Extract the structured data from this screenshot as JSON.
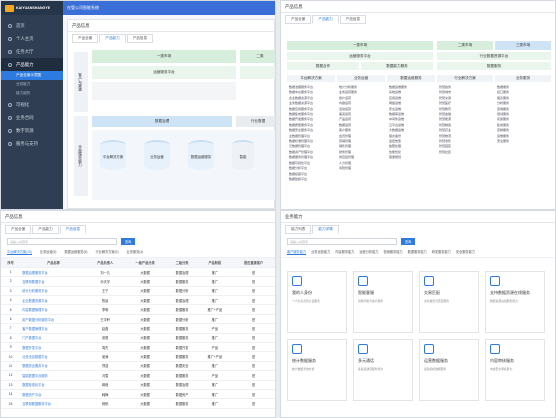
{
  "app": {
    "logo_text": "KAIYUANSHANGYE",
    "top_title": "在管公司智能系统"
  },
  "sidebar": {
    "items": [
      {
        "label": "首页"
      },
      {
        "label": "个人主页"
      },
      {
        "label": "任务大厅"
      },
      {
        "label": "产品能力"
      },
      {
        "label": "可视化"
      },
      {
        "label": "业务合同"
      },
      {
        "label": "数字资源"
      },
      {
        "label": "服务与支持"
      }
    ],
    "subitems": [
      {
        "label": "产品全景示意图"
      },
      {
        "label": "业务能力"
      },
      {
        "label": "能力组件"
      }
    ]
  },
  "panel1": {
    "title": "产品信息",
    "tabs": [
      "产品全景",
      "产品能力",
      "产品信息"
    ],
    "label_left_top": "客户与渠道",
    "label_left_bottom": "全面服务能力",
    "block1": "一类市场",
    "block2": "运营服务平台",
    "block3": "二类",
    "block4": "数据治理",
    "block5": "行业数据",
    "cyl1": "平台解决方案",
    "cyl2": "业务运营",
    "cyl3": "数据运维服务",
    "cyl4": "智能"
  },
  "panel2": {
    "title": "产品信息",
    "tabs": [
      "产品全景",
      "产品能力",
      "产品信息"
    ],
    "a1": "一类市场",
    "a2": "运营服务平台",
    "a3": "数据合作",
    "a4": "数据能力服务",
    "b1": "二类市场",
    "b2": "三类市场",
    "b3": "行业数据资源平台",
    "b4": "数据服务",
    "c_head": [
      "平台解决方案",
      "业务运营",
      "数据运维服务",
      "行业解决方案",
      "业务服务"
    ],
    "c1": [
      "数据治理服务平台",
      "数据中台服务平台",
      "企业数据资源平台",
      "业务数据资源平台",
      "数据应用服务平台",
      "数据集成服务平台",
      "数据开发服务平台",
      "数据质量服务平台",
      "数据安全服务平台",
      "主数据管理平台",
      "数据标准管理平台",
      "元数据管理平台",
      "数据资产管理平台",
      "数据服务管理平台",
      "数据可视化平台",
      "数据分析平台",
      "数据挖掘平台",
      "数据建模平台"
    ],
    "c2": [
      "统计分析服务",
      "业务运营服务",
      "用户运营",
      "内容运营",
      "活动运营",
      "渠道运营",
      "产品运营",
      "数据运营",
      "客户服务",
      "会员管理",
      "营销管理",
      "销售管理",
      "财务管理",
      "供应链管理",
      "人力管理",
      "风险管理"
    ],
    "c3": [
      "数据运维服务",
      "系统运维",
      "应用运维",
      "网络运维",
      "安全运维",
      "数据库运维",
      "中间件运维",
      "云平台运维",
      "大数据运维",
      "容灾备份",
      "监控告警",
      "故障处理",
      "性能优化",
      "容量规划"
    ],
    "c4": [
      "智慧政务",
      "智慧城市",
      "智慧交通",
      "智慧医疗",
      "智慧教育",
      "智慧金融",
      "智慧能源",
      "智慧制造",
      "智慧农业",
      "智慧物流",
      "智慧零售",
      "智慧园区",
      "智慧社区"
    ],
    "c5": [
      "数据服务",
      "接口服务",
      "报表服务",
      "分析服务",
      "咨询服务",
      "培训服务",
      "实施服务",
      "集成服务",
      "定制服务",
      "运维服务",
      "安全服务"
    ]
  },
  "panel3": {
    "title": "产品信息",
    "tabs": [
      "产品全景",
      "产品能力",
      "产品信息"
    ],
    "search_placeholder": "请输入关键字",
    "search_btn": "查询",
    "cats": [
      "平台解决方案(15)",
      "业务运营(6)",
      "数据运维服务(5)",
      "行业解决方案(3)",
      "业务服务(4)"
    ],
    "headers": [
      "序号",
      "产品名称",
      "产品负责人",
      "一级产品分类",
      "二级分类",
      "产品阶段",
      "是否直接客户"
    ],
    "rows": [
      [
        "1",
        "数据治理服务平台",
        "刘一凡",
        "大数据",
        "数据治理",
        "推广",
        "是"
      ],
      [
        "2",
        "互联网数据平台",
        "孙天宇",
        "大数据",
        "数据服务",
        "推广",
        "是"
      ],
      [
        "3",
        "统计分析服务平台",
        "王宁",
        "大数据",
        "数据分析",
        "推广",
        "是"
      ],
      [
        "4",
        "企业数据资源平台",
        "陈晨",
        "大数据",
        "数据治理",
        "推广",
        "是"
      ],
      [
        "5",
        "内容数据管理平台",
        "李明",
        "大数据",
        "数据服务",
        "推广+产品",
        "是"
      ],
      [
        "6",
        "用户数据分析服务平台",
        "王宇轩",
        "大数据",
        "数据分析",
        "推广",
        "是"
      ],
      [
        "7",
        "客户数据管理平台",
        "赵磊",
        "大数据",
        "数据服务",
        "产品",
        "是"
      ],
      [
        "8",
        "门户数据平台",
        "张丽",
        "大数据",
        "数据服务",
        "推广",
        "是"
      ],
      [
        "9",
        "数据开发平台",
        "周杰",
        "大数据",
        "数据开发",
        "产品",
        "是"
      ],
      [
        "10",
        "业务全息数据平台",
        "吴涛",
        "大数据",
        "数据服务",
        "推广+产品",
        "是"
      ],
      [
        "11",
        "数据安全服务平台",
        "郑浩",
        "大数据",
        "数据安全",
        "推广",
        "是"
      ],
      [
        "12",
        "智能数据中台服务",
        "冯雪",
        "大数据",
        "数据服务",
        "产品",
        "是"
      ],
      [
        "13",
        "数据标准化平台",
        "蒋峰",
        "大数据",
        "数据治理",
        "推广",
        "是"
      ],
      [
        "14",
        "数据资产平台",
        "韩梅",
        "大数据",
        "数据资产",
        "推广",
        "是"
      ],
      [
        "15",
        "互联网数据服务平台",
        "杨帆",
        "大数据",
        "数据服务",
        "推广",
        "是"
      ]
    ]
  },
  "panel4": {
    "title": "业务能力",
    "tabs": [
      "能力列表",
      "能力详情"
    ],
    "search_placeholder": "请输入关键字",
    "search_btn": "查询",
    "cats": [
      "客户服务能力",
      "业务运营能力",
      "内容服务能力",
      "运营分析能力",
      "营销服务能力",
      "数据服务能力",
      "研发服务能力",
      "安全服务能力"
    ],
    "cards": [
      {
        "title": "我的人身份",
        "desc": "个人信息身份认证服务"
      },
      {
        "title": "智能客服",
        "desc": "智能问答与客户服务"
      },
      {
        "title": "交易匹配",
        "desc": "交易撮合与匹配服务"
      },
      {
        "title": "支持数据资源在线服务",
        "desc": "数据资源在线服务能力"
      },
      {
        "title": "统计数据服务",
        "desc": "统计数据查询分析"
      },
      {
        "title": "多元通话",
        "desc": "多渠道通话服务能力"
      },
      {
        "title": "运营数据服务",
        "desc": "运营指标数据服务"
      },
      {
        "title": "内容审核服务",
        "desc": "内容安全审核能力"
      }
    ]
  }
}
